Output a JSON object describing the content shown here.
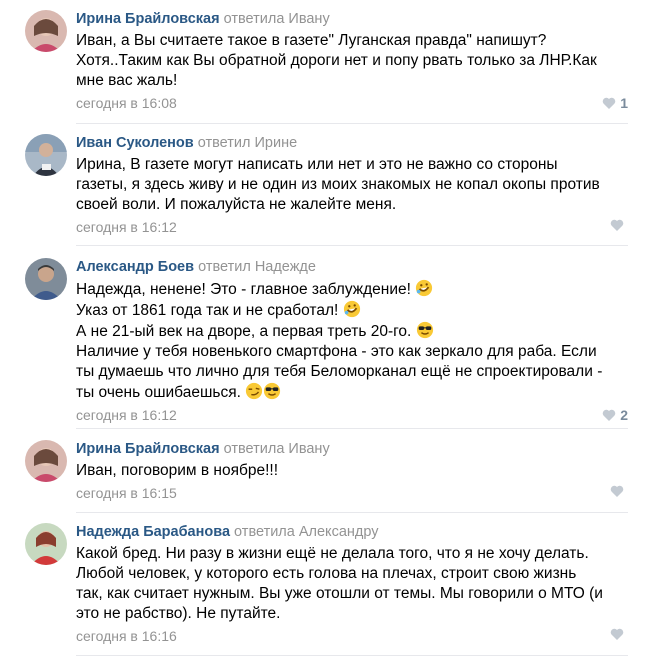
{
  "comments": [
    {
      "author": "Ирина Брайловская",
      "replied": " ответила Ивану",
      "lines": [
        "Иван, а Вы считаете такое в газете\" Луганская правда\" напишут?",
        "Хотя..Таким как Вы обратной дороги нет и попу рвать только за ЛНР.Как",
        "мне вас жаль!"
      ],
      "date": "сегодня в 16:08",
      "likes": "1"
    },
    {
      "author": "Иван Суколенов",
      "replied": " ответил Ирине",
      "lines": [
        "Ирина, В газете могут написать или нет и это не важно со стороны",
        "газеты, я здесь живу и не один из моих знакомых не копал окопы против",
        "своей воли. И пожалуйста не жалейте меня."
      ],
      "date": "сегодня в 16:12",
      "likes": ""
    },
    {
      "author": "Александр Боев",
      "replied": " ответил Надежде",
      "lines": [
        "Надежда, ненене! Это - главное заблуждение!",
        "Указ от 1861 года так и не сработал!",
        "А не 21-ый век на дворе, а первая треть 20-го.",
        "Наличие у тебя новенького смартфона - это как зеркало для раба. Если",
        "ты думаешь что лично для тебя Беломорканал ещё не спроектировали -",
        "ты очень ошибаешься."
      ],
      "date": "сегодня в 16:12",
      "likes": "2"
    },
    {
      "author": "Ирина Брайловская",
      "replied": " ответила Ивану",
      "lines": [
        "Иван, поговорим в ноябре!!!"
      ],
      "date": "сегодня в 16:15",
      "likes": ""
    },
    {
      "author": "Надежда Барабанова",
      "replied": " ответила Александру",
      "lines": [
        "Какой бред. Ни разу в жизни ещё не делала того, что я не хочу делать.",
        "Любой человек, у которого есть голова на плечах, строит свою жизнь",
        "так, как считает нужным. Вы уже отошли от темы. Мы говорили о МТО (и",
        "это не рабство). Не путайте."
      ],
      "date": "сегодня в 16:16",
      "likes": ""
    }
  ]
}
